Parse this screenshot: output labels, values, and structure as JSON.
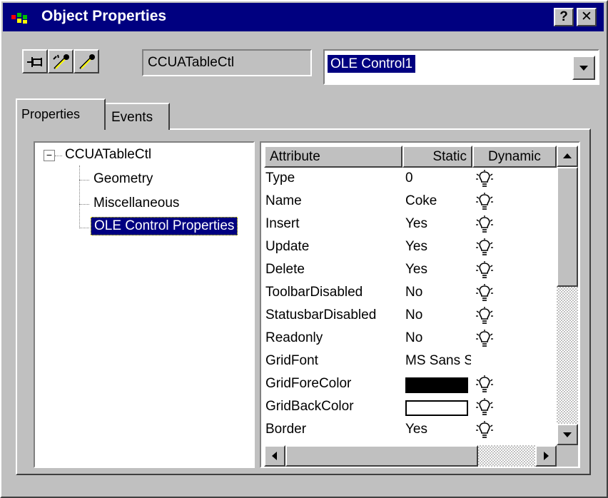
{
  "window": {
    "title": "Object Properties",
    "help_label": "?",
    "close_label": "✕"
  },
  "toolbar": {
    "object_type": "CCUATableCtl",
    "object_name": "OLE Control1"
  },
  "tabs": [
    {
      "label": "Properties"
    },
    {
      "label": "Events"
    }
  ],
  "tree": {
    "root": "CCUATableCtl",
    "expander": "−",
    "children": [
      "Geometry",
      "Miscellaneous",
      "OLE Control Properties"
    ]
  },
  "grid": {
    "headers": [
      "Attribute",
      "Static",
      "Dynamic"
    ],
    "rows": [
      {
        "attribute": "Type",
        "static": "0"
      },
      {
        "attribute": "Name",
        "static": "Coke"
      },
      {
        "attribute": "Insert",
        "static": "Yes"
      },
      {
        "attribute": "Update",
        "static": "Yes"
      },
      {
        "attribute": "Delete",
        "static": "Yes"
      },
      {
        "attribute": "ToolbarDisabled",
        "static": "No"
      },
      {
        "attribute": "StatusbarDisabled",
        "static": "No"
      },
      {
        "attribute": "Readonly",
        "static": "No"
      },
      {
        "attribute": "GridFont",
        "static": "MS Sans Serif"
      },
      {
        "attribute": "GridForeColor",
        "static": ""
      },
      {
        "attribute": "GridBackColor",
        "static": ""
      },
      {
        "attribute": "Border",
        "static": "Yes"
      }
    ]
  },
  "colors": {
    "title_bar": "#000080",
    "selection": "#000080",
    "face": "#c0c0c0",
    "grid_fore_color": "#000000",
    "grid_back_color": "#ffffff"
  },
  "icons": {
    "app": "object-properties-icon",
    "pin": "pin-icon",
    "pick_1": "eyedropper-icon",
    "pick_2": "eyedropper-icon",
    "dynamic": "lightbulb-icon"
  }
}
